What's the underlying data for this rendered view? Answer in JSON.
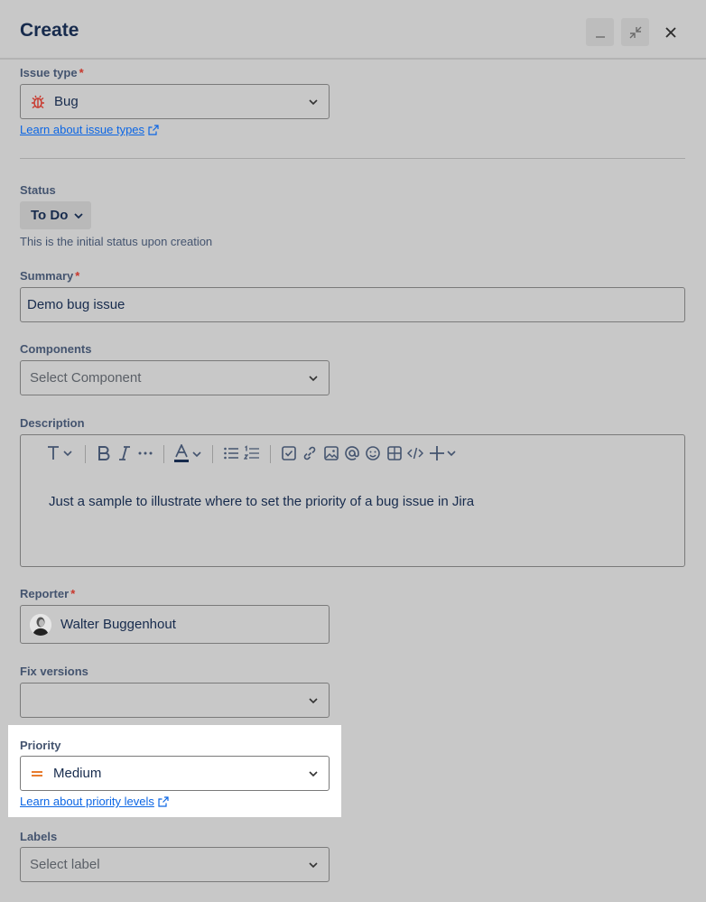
{
  "header": {
    "title": "Create",
    "buttons": [
      "minimize-icon",
      "collapse-icon",
      "close-icon"
    ]
  },
  "issue_type": {
    "label": "Issue type",
    "required": "*",
    "value": "Bug",
    "icon": "bug-icon",
    "link": "Learn about issue types"
  },
  "status": {
    "label": "Status",
    "value": "To Do",
    "helper": "This is the initial status upon creation"
  },
  "summary": {
    "label": "Summary",
    "required": "*",
    "value": "Demo bug issue"
  },
  "components": {
    "label": "Components",
    "placeholder": "Select Component"
  },
  "description": {
    "label": "Description",
    "text": "Just a sample to illustrate where to set the priority of a bug issue in Jira",
    "toolbar": [
      "text-style-icon",
      "bold-icon",
      "italic-icon",
      "more-icon",
      "text-color-icon",
      "bullet-list-icon",
      "numbered-list-icon",
      "checkbox-icon",
      "link-icon",
      "image-icon",
      "mention-icon",
      "emoji-icon",
      "table-icon",
      "code-icon",
      "insert-icon"
    ]
  },
  "reporter": {
    "label": "Reporter",
    "required": "*",
    "value": "Walter Buggenhout"
  },
  "fix_versions": {
    "label": "Fix versions",
    "value": ""
  },
  "priority": {
    "label": "Priority",
    "value": "Medium",
    "icon": "priority-medium-icon",
    "link": "Learn about priority levels",
    "color": "#e56910"
  },
  "labels": {
    "label": "Labels",
    "placeholder": "Select label"
  }
}
